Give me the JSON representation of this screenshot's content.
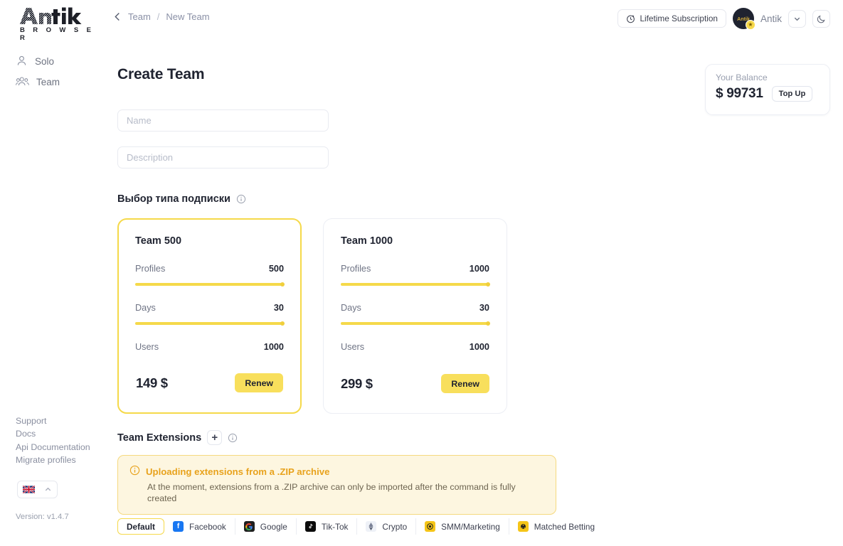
{
  "brand": {
    "name": "Antik",
    "subtitle": "B R O W S E R"
  },
  "sidebar": {
    "nav": [
      {
        "label": "Solo",
        "icon": "user-icon"
      },
      {
        "label": "Team",
        "icon": "users-icon"
      }
    ],
    "links": [
      {
        "label": "Support"
      },
      {
        "label": "Docs"
      },
      {
        "label": "Api Documentation"
      },
      {
        "label": "Migrate profiles"
      }
    ],
    "language": "en-GB",
    "version": "Version: v1.4.7"
  },
  "breadcrumb": {
    "back": "back-icon",
    "parent": "Team",
    "separator": "/",
    "current": "New Team"
  },
  "header": {
    "subscription_label": "Lifetime Subscription",
    "user_name": "Antik",
    "chevron": "chevron-down-icon",
    "theme_toggle": "moon-icon"
  },
  "balance": {
    "label": "Your Balance",
    "amount": "$ 99731",
    "topup_label": "Top Up"
  },
  "main": {
    "title": "Create Team",
    "name_placeholder": "Name",
    "name_value": "",
    "description_placeholder": "Description",
    "description_value": "",
    "subscription_heading": "Выбор типа подписки",
    "extensions_heading": "Team Extensions",
    "add_extension_label": "+"
  },
  "plans": [
    {
      "name": "Team 500",
      "selected": true,
      "metrics": [
        {
          "label": "Profiles",
          "value": "500",
          "slider": 100
        },
        {
          "label": "Days",
          "value": "30",
          "slider": 100
        },
        {
          "label": "Users",
          "value": "1000",
          "slider": null
        }
      ],
      "price": "149 $",
      "action": "Renew"
    },
    {
      "name": "Team 1000",
      "selected": false,
      "metrics": [
        {
          "label": "Profiles",
          "value": "1000",
          "slider": 100
        },
        {
          "label": "Days",
          "value": "30",
          "slider": 100
        },
        {
          "label": "Users",
          "value": "1000",
          "slider": null
        }
      ],
      "price": "299 $",
      "action": "Renew"
    }
  ],
  "alert": {
    "title": "Uploading extensions from a .ZIP archive",
    "text": "At the moment, extensions from a .ZIP archive can only be imported after the command is fully created"
  },
  "chips": [
    {
      "label": "Default",
      "icon": null,
      "active": true
    },
    {
      "label": "Facebook",
      "icon": "facebook-icon",
      "bg": "#1877F2",
      "glyph": "f"
    },
    {
      "label": "Google",
      "icon": "google-icon",
      "bg": "#1f1f1f",
      "glyph": "G"
    },
    {
      "label": "Tik-Tok",
      "icon": "tiktok-icon",
      "bg": "#0b0b0b",
      "glyph": "♪"
    },
    {
      "label": "Crypto",
      "icon": "crypto-icon",
      "bg": "#eef1f7",
      "glyph": "◆"
    },
    {
      "label": "SMM/Marketing",
      "icon": "smm-icon",
      "bg": "#f5c518",
      "glyph": "◎"
    },
    {
      "label": "Matched Betting",
      "icon": "betting-icon",
      "bg": "#f5c518",
      "glyph": "●"
    }
  ],
  "colors": {
    "accent": "#f5d94a",
    "button": "#f8df5c",
    "alert_title": "#e8a21c",
    "alert_bg": "#fdf6e0"
  }
}
